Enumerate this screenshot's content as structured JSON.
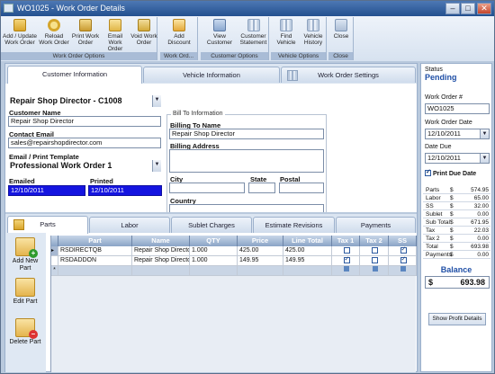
{
  "window": {
    "title": "WO1025 - Work Order Details"
  },
  "ribbon": {
    "buttons": [
      {
        "label": "Add / Update Work Order",
        "icon": "folder-icon"
      },
      {
        "label": "Reload Work Order",
        "icon": "reload-icon"
      },
      {
        "label": "Print Work Order",
        "icon": "print-icon"
      },
      {
        "label": "Email Work Order",
        "icon": "email-icon"
      },
      {
        "label": "Void Work Order",
        "icon": "void-icon"
      },
      {
        "label": "Add Discount",
        "icon": "discount-icon"
      },
      {
        "label": "View Customer",
        "icon": "view-customer-icon"
      },
      {
        "label": "Customer Statement",
        "icon": "statement-icon"
      },
      {
        "label": "Find Vehicle",
        "icon": "find-vehicle-icon"
      },
      {
        "label": "Vehicle History",
        "icon": "vehicle-history-icon"
      },
      {
        "label": "Close",
        "icon": "close-icon"
      }
    ],
    "groups": [
      "Work Order Options",
      "Work Ord...",
      "Customer Options",
      "Vehicle Options",
      "Close"
    ]
  },
  "top_tabs": [
    "Customer Information",
    "Vehicle Information",
    "Work Order Settings"
  ],
  "customer": {
    "selector": "Repair Shop Director - C1008",
    "name_label": "Customer Name",
    "name": "Repair Shop Director",
    "email_label": "Contact Email",
    "email": "sales@repairshopdirector.com",
    "template_label": "Email / Print Template",
    "template": "Professional Work Order 1",
    "emailed_label": "Emailed",
    "emailed": "12/10/2011",
    "printed_label": "Printed",
    "printed": "12/10/2011"
  },
  "bill_to": {
    "legend": "Bill To Information",
    "name_label": "Billing To Name",
    "name": "Repair Shop Director",
    "address_label": "Billing Address",
    "city_label": "City",
    "state_label": "State",
    "postal_label": "Postal",
    "country_label": "Country"
  },
  "bottom_tabs": [
    "Parts",
    "Labor",
    "Sublet Charges",
    "Estimate Revisions",
    "Payments"
  ],
  "side_actions": [
    "Add New Part",
    "Edit Part",
    "Delete Part"
  ],
  "grid": {
    "headers": [
      "Part",
      "Name",
      "QTY",
      "Price",
      "Line Total",
      "Tax 1",
      "Tax 2",
      "SS"
    ],
    "rows": [
      {
        "part": "RSDIRECTQB",
        "name": "Repair Shop Director",
        "qty": "1.000",
        "price": "425.00",
        "total": "425.00",
        "tax1": false,
        "tax2": false,
        "ss": true
      },
      {
        "part": "RSDADDON",
        "name": "Repair Shop Director",
        "qty": "1.000",
        "price": "149.95",
        "total": "149.95",
        "tax1": true,
        "tax2": false,
        "ss": true
      }
    ]
  },
  "right": {
    "status_label": "Status",
    "status": "Pending",
    "wo_label": "Work Order #",
    "wo": "WO1025",
    "wo_date_label": "Work Order Date",
    "wo_date": "12/10/2011",
    "due_label": "Date Due",
    "due": "12/10/2011",
    "print_due_label": "Print Due Date",
    "summary": [
      {
        "k": "Parts",
        "v": "574.95"
      },
      {
        "k": "Labor",
        "v": "65.00"
      },
      {
        "k": "SS",
        "v": "32.00"
      },
      {
        "k": "Sublet",
        "v": "0.00"
      },
      {
        "k": "Sub Total",
        "v": "671.95"
      },
      {
        "k": "Tax",
        "v": "22.03"
      },
      {
        "k": "Tax 2",
        "v": "0.00"
      },
      {
        "k": "Total",
        "v": "693.98"
      },
      {
        "k": "Payments",
        "v": "0.00"
      }
    ],
    "currency": "$",
    "balance_label": "Balance",
    "balance": "693.98",
    "profit_button": "Show Profit Details"
  }
}
